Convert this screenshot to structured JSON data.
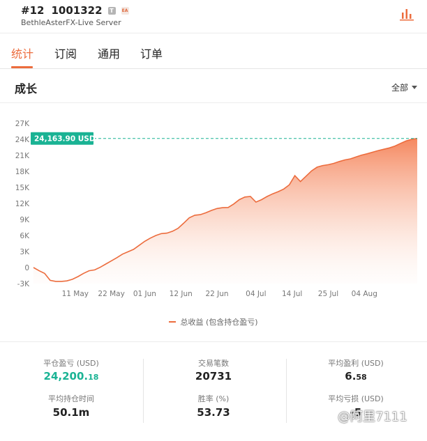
{
  "header": {
    "rank": "#12",
    "account_id": "1001322",
    "badge_t": "T",
    "badge_ea": "EA",
    "server": "BethleAsterFX-Live Server"
  },
  "tabs": [
    {
      "label": "统计",
      "active": true
    },
    {
      "label": "订阅",
      "active": false
    },
    {
      "label": "通用",
      "active": false
    },
    {
      "label": "订单",
      "active": false
    }
  ],
  "section": {
    "title": "成长",
    "range": "全部"
  },
  "colors": {
    "accent": "#ec6c3d",
    "marker": "#1ab394"
  },
  "chart_data": {
    "type": "area",
    "series": [
      {
        "name": "总收益 (包含持仓盈亏)",
        "points": [
          [
            0,
            0
          ],
          [
            1,
            -600
          ],
          [
            2,
            -1100
          ],
          [
            3,
            -2400
          ],
          [
            4,
            -2600
          ],
          [
            5,
            -2600
          ],
          [
            6,
            -2500
          ],
          [
            7,
            -2200
          ],
          [
            8,
            -1700
          ],
          [
            9,
            -1100
          ],
          [
            10,
            -600
          ],
          [
            11,
            -450
          ],
          [
            12,
            50
          ],
          [
            13,
            650
          ],
          [
            14,
            1250
          ],
          [
            15,
            1850
          ],
          [
            16,
            2500
          ],
          [
            17,
            2950
          ],
          [
            18,
            3400
          ],
          [
            19,
            4150
          ],
          [
            20,
            4900
          ],
          [
            21,
            5500
          ],
          [
            22,
            6000
          ],
          [
            23,
            6350
          ],
          [
            24,
            6450
          ],
          [
            25,
            6800
          ],
          [
            26,
            7350
          ],
          [
            27,
            8300
          ],
          [
            28,
            9300
          ],
          [
            29,
            9800
          ],
          [
            30,
            9900
          ],
          [
            31,
            10250
          ],
          [
            32,
            10700
          ],
          [
            33,
            11050
          ],
          [
            34,
            11200
          ],
          [
            35,
            11250
          ],
          [
            36,
            11900
          ],
          [
            37,
            12700
          ],
          [
            38,
            13200
          ],
          [
            39,
            13300
          ],
          [
            40,
            12250
          ],
          [
            41,
            12700
          ],
          [
            42,
            13300
          ],
          [
            43,
            13800
          ],
          [
            44,
            14200
          ],
          [
            45,
            14700
          ],
          [
            46,
            15500
          ],
          [
            47,
            17200
          ],
          [
            48,
            16100
          ],
          [
            49,
            17100
          ],
          [
            50,
            18100
          ],
          [
            51,
            18800
          ],
          [
            52,
            19100
          ],
          [
            53,
            19250
          ],
          [
            54,
            19500
          ],
          [
            55,
            19850
          ],
          [
            56,
            20150
          ],
          [
            57,
            20350
          ],
          [
            58,
            20700
          ],
          [
            59,
            21050
          ],
          [
            60,
            21300
          ],
          [
            61,
            21600
          ],
          [
            62,
            21900
          ],
          [
            63,
            22150
          ],
          [
            64,
            22400
          ],
          [
            65,
            22750
          ],
          [
            66,
            23250
          ],
          [
            67,
            23700
          ],
          [
            68,
            24000
          ],
          [
            69,
            24163.9
          ]
        ]
      }
    ],
    "x_tick_labels": [
      "11 May",
      "22 May",
      "01 Jun",
      "12 Jun",
      "22 Jun",
      "04 Jul",
      "14 Jul",
      "25 Jul",
      "04 Aug"
    ],
    "x_tick_positions": [
      7.5,
      14,
      20,
      26.5,
      33,
      40,
      46.5,
      53,
      59.5
    ],
    "x_range": [
      0,
      69
    ],
    "y_tick_labels": [
      "27K",
      "24K",
      "21K",
      "18K",
      "15K",
      "12K",
      "9K",
      "6K",
      "3K",
      "0",
      "-3K"
    ],
    "y_ticks": [
      27000,
      24000,
      21000,
      18000,
      15000,
      12000,
      9000,
      6000,
      3000,
      0,
      -3000
    ],
    "ylim": [
      -3000,
      27000
    ],
    "marker_value": 24163.9,
    "marker_label": "24,163.90 USD",
    "grid": false,
    "legend_position": "bottom"
  },
  "stats": {
    "closed_pnl_label": "平仓盈亏 (USD)",
    "closed_pnl_int": "24,200.",
    "closed_pnl_dec": "18",
    "avg_hold_label": "平均持仓时间",
    "avg_hold_value": "50.1m",
    "trades_label": "交易笔数",
    "trades_value": "20731",
    "win_rate_label": "胜率 (%)",
    "win_rate_value": "53.73",
    "avg_profit_label": "平均盈利 (USD)",
    "avg_profit_int": "6.",
    "avg_profit_dec": "58",
    "avg_loss_label": "平均亏损 (USD)",
    "avg_loss_value": "-5"
  },
  "watermark": "@阿里7111"
}
